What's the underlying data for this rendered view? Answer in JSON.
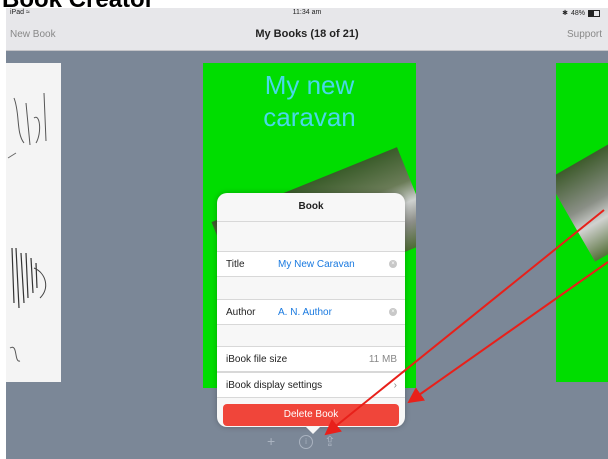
{
  "doc_heading": "Book Creator",
  "statusbar": {
    "device": "iPad",
    "wifi_glyph": "≈",
    "time": "11:34 am",
    "bluetooth_glyph": "✱",
    "battery": "48%",
    "battery_level": 0.48
  },
  "navbar": {
    "left": "New Book",
    "title": "My Books (18 of 21)",
    "right": "Support"
  },
  "book_center": {
    "title_line1": "My new",
    "title_line2": "caravan"
  },
  "popover": {
    "header": "Book",
    "title_label": "Title",
    "title_value": "My New Caravan",
    "author_label": "Author",
    "author_value": "A. N. Author",
    "filesize_label": "iBook file size",
    "filesize_value": "11 MB",
    "display_label": "iBook display settings",
    "display_chevron": "›",
    "delete_label": "Delete Book",
    "clear_glyph": "×"
  },
  "toolbar": {
    "add_glyph": "+",
    "info_glyph": "i",
    "share_glyph": "⇪"
  },
  "colors": {
    "screen_bg": "#7b8797",
    "cover_green": "#00dd00",
    "cover_title": "#49d8e8",
    "link_blue": "#1a7ae0",
    "delete_red": "#f0453a",
    "arrow_red": "#e8201a"
  }
}
